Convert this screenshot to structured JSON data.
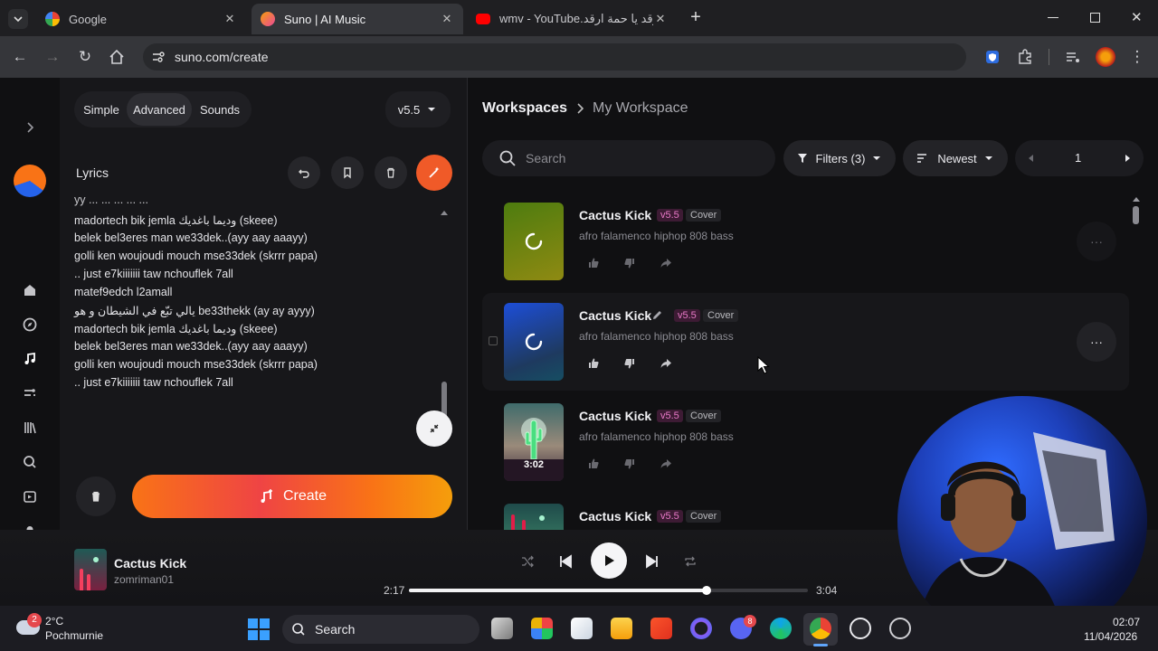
{
  "browser": {
    "tabs": [
      {
        "title": "Google",
        "active": false
      },
      {
        "title": "Suno | AI Music",
        "active": true
      },
      {
        "title": "wmv - YouTube.ارقد يا حمة ارقد",
        "active": false
      }
    ],
    "url": "suno.com/create"
  },
  "create_panel": {
    "modes": [
      "Simple",
      "Advanced",
      "Sounds"
    ],
    "active_mode": "Advanced",
    "model_version": "v5.5",
    "lyrics_label": "Lyrics",
    "lyrics_lines": [
      "madortech bik jemla وديما باغديك (skeee)",
      "belek bel3eres man we33dek..(ayy aay aaayy)",
      "golli ken woujoudi mouch mse33dek (skrrr papa)",
      ".. just e7kiiiiiii  taw nchouflek 7all",
      "matef9edch l2amall",
      "يالي تبّع في الشيطان و هو be33thekk (ay ay ayyy)",
      "madortech bik jemla وديما باغديك (skeee)",
      "belek bel3eres man we33dek..(ayy aay aaayy)",
      "golli ken woujoudi mouch mse33dek (skrrr papa)",
      ".. just e7kiiiiiii  taw nchouflek 7all"
    ],
    "create_label": "Create"
  },
  "workspace": {
    "breadcrumb_root": "Workspaces",
    "breadcrumb_current": "My Workspace",
    "search_placeholder": "Search",
    "filters_label": "Filters (3)",
    "sort_label": "Newest",
    "page": "1"
  },
  "songs": [
    {
      "title": "Cactus Kick",
      "version": "v5.5",
      "tag": "Cover",
      "description": "afro falamenco hiphop 808 bass",
      "duration": ""
    },
    {
      "title": "Cactus Kick",
      "version": "v5.5",
      "tag": "Cover",
      "description": "afro falamenco hiphop 808 bass",
      "duration": ""
    },
    {
      "title": "Cactus Kick",
      "version": "v5.5",
      "tag": "Cover",
      "description": "afro falamenco hiphop 808 bass",
      "duration": "3:02"
    },
    {
      "title": "Cactus Kick",
      "version": "v5.5",
      "tag": "Cover",
      "description": "",
      "duration": ""
    }
  ],
  "player": {
    "title": "Cactus Kick",
    "artist": "zomriman01",
    "elapsed": "2:17",
    "total": "3:04",
    "progress": 0.745
  },
  "taskbar": {
    "weather_temp": "2°C",
    "weather_place": "Pochmurnie",
    "weather_badge": "2",
    "search_label": "Search",
    "time": "02:07",
    "date": "11/04/2026",
    "discord_badge": "8"
  },
  "colors": {
    "accent_orange": "#f05a28",
    "version_pink": "#e879c7"
  }
}
